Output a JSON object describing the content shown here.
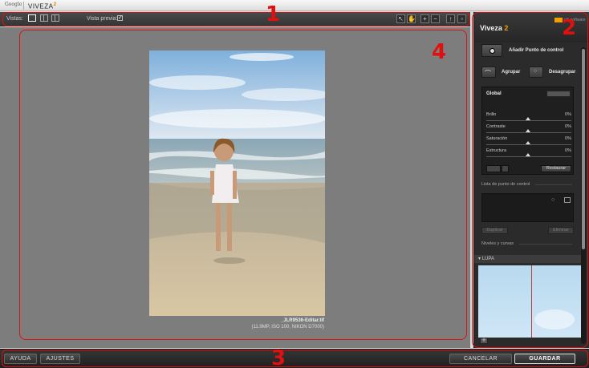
{
  "titlebar": {
    "vendor": "Google",
    "app_name": "VIVEZA",
    "app_version": "2"
  },
  "toolbar": {
    "views_label": "Vistas:",
    "preview_label": "Vista previa:",
    "preview_checked": true
  },
  "image": {
    "filename": "_JLR9536-Editar.tif",
    "meta": "(11.9MP, ISO 100, NIKON D7000)"
  },
  "panel": {
    "brand": "Viveza",
    "brand_version": "2",
    "ni_text": "nik software",
    "add_control_point": "Añadir Punto de control",
    "group": "Agrupar",
    "ungroup": "Desagrupar",
    "global_title": "Global",
    "sliders": [
      {
        "label": "Brillo",
        "value": "0%"
      },
      {
        "label": "Contraste",
        "value": "0%"
      },
      {
        "label": "Saturación",
        "value": "0%"
      },
      {
        "label": "Estructura",
        "value": "0%"
      }
    ],
    "reset": "Restaurar",
    "cp_list_label": "Lista de punto de control",
    "duplicate": "Duplicar",
    "delete": "Eliminar",
    "levels_label": "Niveles y curvas",
    "loupe_label": "LUPA"
  },
  "bottombar": {
    "help": "AYUDA",
    "settings": "AJUSTES",
    "cancel": "CANCELAR",
    "save": "GUARDAR"
  },
  "annotations": [
    "1",
    "2",
    "3",
    "4"
  ],
  "colors": {
    "annotation": "#e01010",
    "accent": "#f0a000",
    "canvas": "#7d7d7d"
  }
}
